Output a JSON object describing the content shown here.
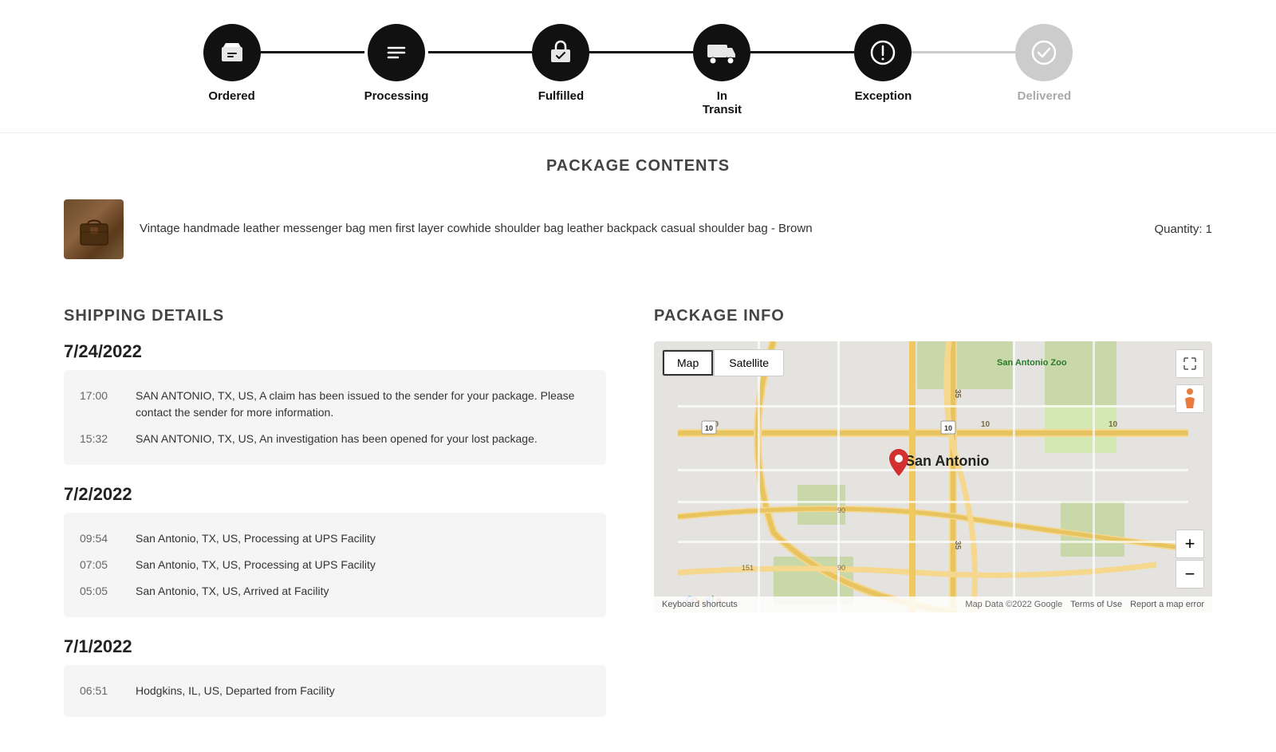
{
  "progress": {
    "steps": [
      {
        "id": "ordered",
        "label": "Ordered",
        "icon": "🛍",
        "active": true
      },
      {
        "id": "processing",
        "label": "Processing",
        "icon": "☰",
        "active": true
      },
      {
        "id": "fulfilled",
        "label": "Fulfilled",
        "icon": "📦",
        "active": true
      },
      {
        "id": "in-transit",
        "label": "In\nTransit",
        "icon": "🚚",
        "active": true
      },
      {
        "id": "exception",
        "label": "Exception",
        "icon": "⚠",
        "active": true
      },
      {
        "id": "delivered",
        "label": "Delivered",
        "icon": "✓",
        "active": false
      }
    ],
    "connectors": [
      true,
      true,
      true,
      true,
      false
    ]
  },
  "package_contents": {
    "section_title": "PACKAGE CONTENTS",
    "item": {
      "description": "Vintage handmade leather messenger bag men first layer cowhide shoulder bag leather backpack casual shoulder bag - Brown",
      "quantity_label": "Quantity: 1"
    }
  },
  "shipping_details": {
    "section_title": "SHIPPING DETAILS",
    "date_groups": [
      {
        "date": "7/24/2022",
        "events": [
          {
            "time": "17:00",
            "description": "SAN ANTONIO, TX, US, A claim has been issued to the sender for your package. Please contact the sender for more information."
          },
          {
            "time": "15:32",
            "description": "SAN ANTONIO, TX, US, An investigation has been opened for your lost package."
          }
        ]
      },
      {
        "date": "7/2/2022",
        "events": [
          {
            "time": "09:54",
            "description": "San Antonio, TX, US, Processing at UPS Facility"
          },
          {
            "time": "07:05",
            "description": "San Antonio, TX, US, Processing at UPS Facility"
          },
          {
            "time": "05:05",
            "description": "San Antonio, TX, US, Arrived at Facility"
          }
        ]
      },
      {
        "date": "7/1/2022",
        "events": [
          {
            "time": "06:51",
            "description": "Hodgkins, IL, US, Departed from Facility"
          }
        ]
      }
    ]
  },
  "package_info": {
    "section_title": "PACKAGE INFO",
    "map": {
      "map_tab": "Map",
      "satellite_tab": "Satellite",
      "city_label": "San Antonio",
      "footer": {
        "google": "Google",
        "keyboard": "Keyboard shortcuts",
        "map_data": "Map Data ©2022 Google",
        "terms": "Terms of Use",
        "report": "Report a map error"
      }
    }
  }
}
